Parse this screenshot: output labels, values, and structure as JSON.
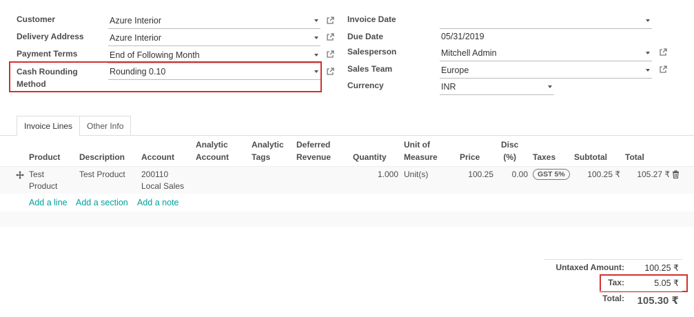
{
  "left_form": {
    "customer": {
      "label": "Customer",
      "value": "Azure Interior"
    },
    "delivery_address": {
      "label": "Delivery Address",
      "value": "Azure Interior"
    },
    "payment_terms": {
      "label": "Payment Terms",
      "value": "End of Following Month"
    },
    "cash_rounding": {
      "label_line1": "Cash Rounding",
      "label_line2": "Method",
      "value": "Rounding 0.10"
    }
  },
  "right_form": {
    "invoice_date": {
      "label": "Invoice Date",
      "value": ""
    },
    "due_date": {
      "label": "Due Date",
      "value": "05/31/2019"
    },
    "salesperson": {
      "label": "Salesperson",
      "value": "Mitchell Admin"
    },
    "sales_team": {
      "label": "Sales Team",
      "value": "Europe"
    },
    "currency": {
      "label": "Currency",
      "value": "INR"
    }
  },
  "tabs": [
    {
      "label": "Invoice Lines",
      "active": true
    },
    {
      "label": "Other Info",
      "active": false
    }
  ],
  "table": {
    "headers": {
      "product": "Product",
      "description": "Description",
      "account": "Account",
      "analytic_account": [
        "Analytic",
        "Account"
      ],
      "analytic_tags": [
        "Analytic",
        "Tags"
      ],
      "deferred_revenue": [
        "Deferred",
        "Revenue"
      ],
      "quantity": "Quantity",
      "uom": [
        "Unit of",
        "Measure"
      ],
      "price": "Price",
      "disc": [
        "Disc",
        "(%)"
      ],
      "taxes": "Taxes",
      "subtotal": "Subtotal",
      "total": "Total"
    },
    "row": {
      "product": [
        "Test",
        "Product"
      ],
      "description": "Test Product",
      "account": [
        "200110",
        "Local Sales"
      ],
      "quantity": "1.000",
      "uom": "Unit(s)",
      "price": "100.25",
      "disc": "0.00",
      "tax_badge": "GST 5%",
      "subtotal": "100.25 ₹",
      "total": "105.27 ₹"
    },
    "actions": {
      "add_line": "Add a line",
      "add_section": "Add a section",
      "add_note": "Add a note"
    }
  },
  "totals": {
    "untaxed": {
      "label": "Untaxed Amount:",
      "value": "100.25 ₹"
    },
    "tax": {
      "label": "Tax:",
      "value": "5.05 ₹"
    },
    "total": {
      "label": "Total:",
      "value": "105.30 ₹"
    }
  },
  "icons": [
    "external-link-icon",
    "drag-handle-icon",
    "trash-icon",
    "dropdown-caret-icon"
  ],
  "colors": {
    "highlight": "#d32f2f",
    "link": "#00a09d"
  }
}
